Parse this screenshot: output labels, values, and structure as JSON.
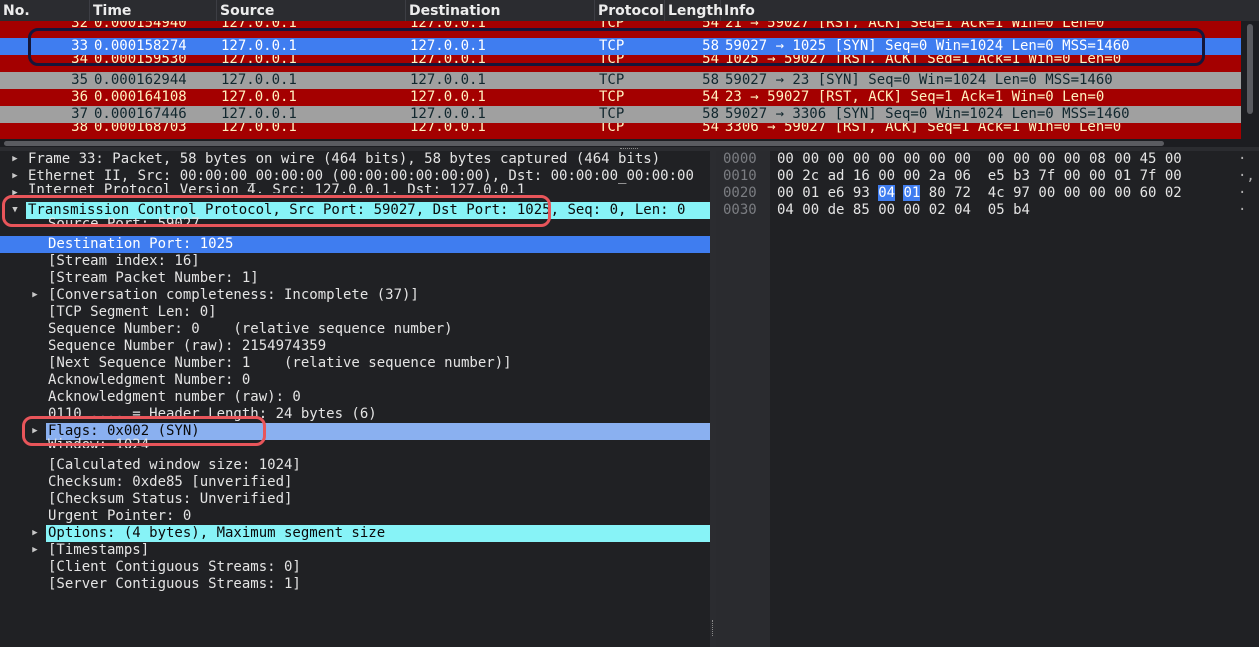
{
  "packet_list": {
    "columns": [
      "No.",
      "Time",
      "Source",
      "Destination",
      "Protocol",
      "Length",
      "Info"
    ],
    "rows": [
      {
        "no": "32",
        "time": "0.000154940",
        "source": "127.0.0.1",
        "destination": "127.0.0.1",
        "protocol": "TCP",
        "length": "54",
        "info": "21 → 59027 [RST, ACK] Seq=1 Ack=1 Win=0 Len=0",
        "style": "red",
        "partial": true
      },
      {
        "no": "33",
        "time": "0.000158274",
        "source": "127.0.0.1",
        "destination": "127.0.0.1",
        "protocol": "TCP",
        "length": "58",
        "info": "59027 → 1025 [SYN] Seq=0 Win=1024 Len=0 MSS=1460",
        "style": "selected"
      },
      {
        "no": "34",
        "time": "0.000159530",
        "source": "127.0.0.1",
        "destination": "127.0.0.1",
        "protocol": "TCP",
        "length": "54",
        "info": "1025 → 59027 [RST, ACK] Seq=1 Ack=1 Win=0 Len=0",
        "style": "red",
        "partial": true
      },
      {
        "no": "35",
        "time": "0.000162944",
        "source": "127.0.0.1",
        "destination": "127.0.0.1",
        "protocol": "TCP",
        "length": "58",
        "info": "59027 → 23 [SYN] Seq=0 Win=1024 Len=0 MSS=1460",
        "style": "gray"
      },
      {
        "no": "36",
        "time": "0.000164108",
        "source": "127.0.0.1",
        "destination": "127.0.0.1",
        "protocol": "TCP",
        "length": "54",
        "info": "23 → 59027 [RST, ACK] Seq=1 Ack=1 Win=0 Len=0",
        "style": "red"
      },
      {
        "no": "37",
        "time": "0.000167446",
        "source": "127.0.0.1",
        "destination": "127.0.0.1",
        "protocol": "TCP",
        "length": "58",
        "info": "59027 → 3306 [SYN] Seq=0 Win=1024 Len=0 MSS=1460",
        "style": "gray"
      },
      {
        "no": "38",
        "time": "0.000168703",
        "source": "127.0.0.1",
        "destination": "127.0.0.1",
        "protocol": "TCP",
        "length": "54",
        "info": "3306 → 59027 [RST, ACK] Seq=1 Ack=1 Win=0 Len=0",
        "style": "red",
        "partial": true
      }
    ]
  },
  "details": [
    {
      "indent": 0,
      "expander": "closed",
      "text": "Frame 33: Packet, 58 bytes on wire (464 bits), 58 bytes captured (464 bits)"
    },
    {
      "indent": 0,
      "expander": "closed",
      "text": "Ethernet II, Src: 00:00:00_00:00:00 (00:00:00:00:00:00), Dst: 00:00:00_00:00:00"
    },
    {
      "indent": 0,
      "expander": "closed",
      "text": "Internet Protocol Version 4, Src: 127.0.0.1, Dst: 127.0.0.1",
      "partial": true
    },
    {
      "indent": 0,
      "expander": "open",
      "text": "Transmission Control Protocol, Src Port: 59027, Dst Port: 1025, Seq: 0, Len: 0",
      "highlight": "cyan"
    },
    {
      "indent": 1,
      "expander": "",
      "text": "Source Port: 59027",
      "partial": true
    },
    {
      "indent": 1,
      "expander": "",
      "text": "Destination Port: 1025",
      "highlight": "blue"
    },
    {
      "indent": 1,
      "expander": "",
      "text": "[Stream index: 16]"
    },
    {
      "indent": 1,
      "expander": "",
      "text": "[Stream Packet Number: 1]"
    },
    {
      "indent": 1,
      "expander": "closed",
      "text": "[Conversation completeness: Incomplete (37)]"
    },
    {
      "indent": 1,
      "expander": "",
      "text": "[TCP Segment Len: 0]"
    },
    {
      "indent": 1,
      "expander": "",
      "text": "Sequence Number: 0    (relative sequence number)"
    },
    {
      "indent": 1,
      "expander": "",
      "text": "Sequence Number (raw): 2154974359"
    },
    {
      "indent": 1,
      "expander": "",
      "text": "[Next Sequence Number: 1    (relative sequence number)]"
    },
    {
      "indent": 1,
      "expander": "",
      "text": "Acknowledgment Number: 0"
    },
    {
      "indent": 1,
      "expander": "",
      "text": "Acknowledgment number (raw): 0"
    },
    {
      "indent": 1,
      "expander": "",
      "text": "0110 .... = Header Length: 24 bytes (6)"
    },
    {
      "indent": 1,
      "expander": "closed",
      "text": "Flags: 0x002 (SYN)",
      "highlight": "lblue"
    },
    {
      "indent": 1,
      "expander": "",
      "text": "Window: 1024",
      "partial": true
    },
    {
      "indent": 1,
      "expander": "",
      "text": "[Calculated window size: 1024]"
    },
    {
      "indent": 1,
      "expander": "",
      "text": "Checksum: 0xde85 [unverified]"
    },
    {
      "indent": 1,
      "expander": "",
      "text": "[Checksum Status: Unverified]"
    },
    {
      "indent": 1,
      "expander": "",
      "text": "Urgent Pointer: 0"
    },
    {
      "indent": 1,
      "expander": "closed",
      "text": "Options: (4 bytes), Maximum segment size",
      "highlight": "cyan"
    },
    {
      "indent": 1,
      "expander": "closed",
      "text": "[Timestamps]"
    },
    {
      "indent": 1,
      "expander": "",
      "text": "[Client Contiguous Streams: 0]"
    },
    {
      "indent": 1,
      "expander": "",
      "text": "[Server Contiguous Streams: 1]"
    }
  ],
  "hex": [
    {
      "offset": "0000",
      "bytes": [
        "00",
        "00",
        "00",
        "00",
        "00",
        "00",
        "00",
        "00",
        "00",
        "00",
        "00",
        "00",
        "08",
        "00",
        "45",
        "00"
      ],
      "ascii": "·"
    },
    {
      "offset": "0010",
      "bytes": [
        "00",
        "2c",
        "ad",
        "16",
        "00",
        "00",
        "2a",
        "06",
        "e5",
        "b3",
        "7f",
        "00",
        "00",
        "01",
        "7f",
        "00"
      ],
      "ascii": "·,"
    },
    {
      "offset": "0020",
      "bytes": [
        "00",
        "01",
        "e6",
        "93",
        "04",
        "01",
        "80",
        "72",
        "4c",
        "97",
        "00",
        "00",
        "00",
        "00",
        "60",
        "02"
      ],
      "ascii": "·"
    },
    {
      "offset": "0030",
      "bytes": [
        "04",
        "00",
        "de",
        "85",
        "00",
        "00",
        "02",
        "04",
        "05",
        "b4"
      ],
      "ascii": "·"
    }
  ],
  "hex_selection": {
    "row": 2,
    "start": 4,
    "end": 5
  },
  "colors": {
    "row_red": "#a40000",
    "row_red_text": "#fff2c0",
    "row_gray": "#a0a0a0",
    "row_gray_text": "#12272e",
    "row_selected": "#3f7df0",
    "highlight_cyan": "#87f3f7",
    "annotation_navy": "#14163a",
    "annotation_red": "#e8555a"
  }
}
